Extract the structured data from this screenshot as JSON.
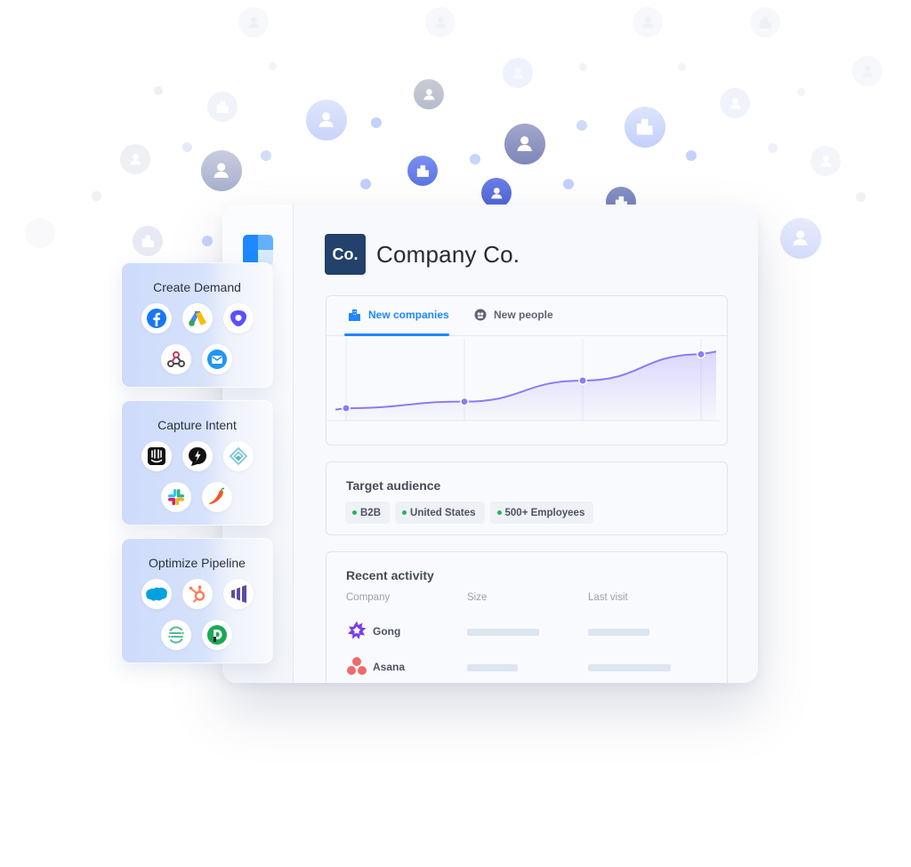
{
  "company": {
    "avatar_text": "Co.",
    "name": "Company Co."
  },
  "tabs": [
    {
      "label": "New companies",
      "icon": "buildings-icon",
      "active": true
    },
    {
      "label": "New people",
      "icon": "people-icon",
      "active": false
    }
  ],
  "chart_data": {
    "type": "area",
    "title": "",
    "xlabel": "",
    "ylabel": "",
    "x": [
      0,
      1,
      2,
      3
    ],
    "series": [
      {
        "name": "New companies",
        "values": [
          4,
          9,
          25,
          45
        ]
      }
    ],
    "ylim": [
      0,
      50
    ],
    "grid": "vertical",
    "legend": "none",
    "accent_color": "#8b7cf6"
  },
  "target_audience": {
    "title": "Target audience",
    "chips": [
      "B2B",
      "United States",
      "500+ Employees"
    ],
    "dot_color": "#22b55e"
  },
  "recent_activity": {
    "title": "Recent activity",
    "columns": [
      "Company",
      "Size",
      "Last visit"
    ],
    "rows": [
      {
        "company": "Gong",
        "logo": "gong-logo-icon",
        "size_bar": 0.55,
        "visit_bar": 0.47
      },
      {
        "company": "Asana",
        "logo": "asana-logo-icon",
        "size_bar": 0.39,
        "visit_bar": 0.63
      }
    ]
  },
  "panels": [
    {
      "title": "Create Demand",
      "icons": [
        "facebook-icon",
        "google-ads-icon",
        "outreach-icon",
        "webhook-icon",
        "email-icon"
      ]
    },
    {
      "title": "Capture Intent",
      "icons": [
        "intercom-icon",
        "drift-icon",
        "hull-icon",
        "slack-icon",
        "zapier-chili-icon"
      ]
    },
    {
      "title": "Optimize Pipeline",
      "icons": [
        "salesforce-icon",
        "hubspot-icon",
        "marketo-icon",
        "segment-icon",
        "pipedrive-icon"
      ]
    }
  ],
  "colors": {
    "brand_blue": "#1e88ff",
    "navy": "#22416b",
    "chart_purple": "#8b7cf6"
  }
}
